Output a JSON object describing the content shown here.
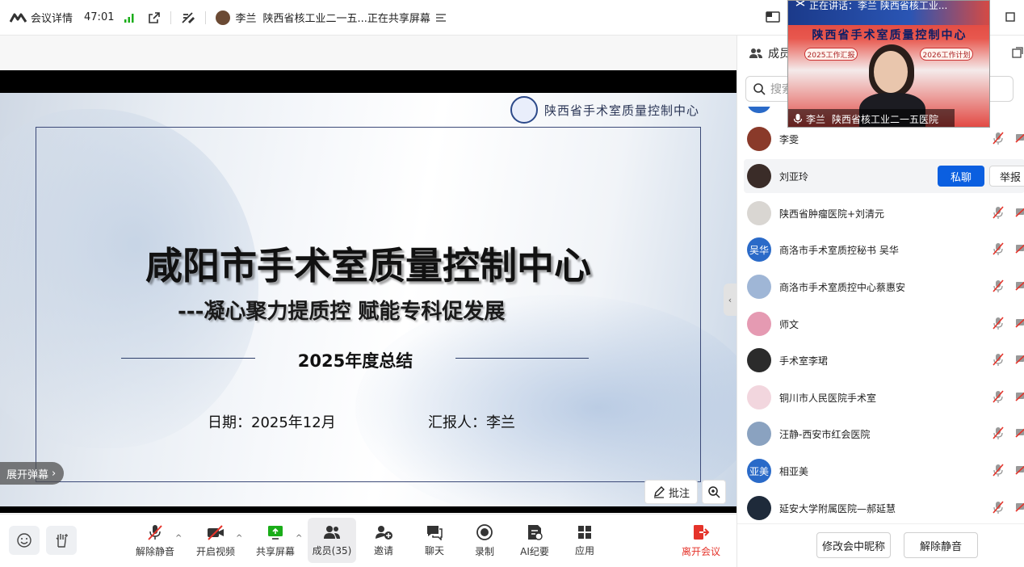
{
  "topbar": {
    "meeting_details_label": "会议详情",
    "duration": "47:01",
    "sharer_name": "李兰",
    "sharing_status": "陕西省核工业二一五...正在共享屏幕",
    "right_text": "?"
  },
  "slide": {
    "logo_text": "陕西省手术室质量控制中心",
    "title": "咸阳市手术室质量控制中心",
    "subtitle": "---凝心聚力提质控 赋能专科促发展",
    "year_summary": "2025年度总结",
    "date": "日期：2025年12月",
    "reporter": "汇报人：李兰"
  },
  "stage_controls": {
    "danmu_label": "展开弹幕",
    "annotate_label": "批注"
  },
  "toolbar": {
    "unmute_label": "解除静音",
    "start_video_label": "开启视频",
    "share_screen_label": "共享屏幕",
    "members_label": "成员(35)",
    "invite_label": "邀请",
    "chat_label": "聊天",
    "record_label": "录制",
    "ai_minutes_label": "AI纪要",
    "apps_label": "应用",
    "leave_label": "离开会议"
  },
  "panel": {
    "title": "成员",
    "search_placeholder": "搜索",
    "private_chat_label": "私聊",
    "report_label": "举报",
    "change_nickname_label": "修改会中昵称",
    "unmute_all_label": "解除静音",
    "members": [
      {
        "name": "李雯",
        "avatar": "photo-avatar",
        "avatar_color": "#8a3a2a"
      },
      {
        "name": "刘亚玲",
        "avatar": "cartoon-avatar",
        "avatar_color": "#3a2c28"
      },
      {
        "name": "陕西省肿瘤医院+刘清元",
        "avatar": "cat-avatar",
        "avatar_color": "#d9d6d2"
      },
      {
        "name": "商洛市手术室质控秘书 吴华",
        "avatar_text": "吴华",
        "avatar_color": "#2a6ac8"
      },
      {
        "name": "商洛市手术室质控中心蔡惠安",
        "avatar": "cartoon-avatar",
        "avatar_color": "#9fb6d6"
      },
      {
        "name": "师文",
        "avatar": "photo-avatar",
        "avatar_color": "#e59ab2"
      },
      {
        "name": "手术室李珺",
        "avatar": "photo-avatar",
        "avatar_color": "#2b2b2b"
      },
      {
        "name": "铜川市人民医院手术室",
        "avatar": "logo-avatar",
        "avatar_color": "#f2d6de"
      },
      {
        "name": "汪静-西安市红会医院",
        "avatar": "photo-avatar",
        "avatar_color": "#8aa2c0"
      },
      {
        "name": "相亚美",
        "avatar_text": "亚美",
        "avatar_color": "#2a6ac8"
      },
      {
        "name": "延安大学附属医院—郝延慧",
        "avatar": "photo-avatar",
        "avatar_color": "#1e2a3a"
      }
    ]
  },
  "video": {
    "speaking_text": "正在讲话：李兰  陕西省核工业...",
    "banner_title": "陕西省手术室质量控制中心",
    "tag_left": "2025工作汇报",
    "tag_right": "2026工作计划",
    "speaker_name": "李兰",
    "speaker_org": "陕西省核工业二一五医院"
  },
  "colors": {
    "accent_blue": "#0b5fe0",
    "leave_red": "#e5332a",
    "mute_red": "#e5332a",
    "signal_green": "#1aad19"
  }
}
